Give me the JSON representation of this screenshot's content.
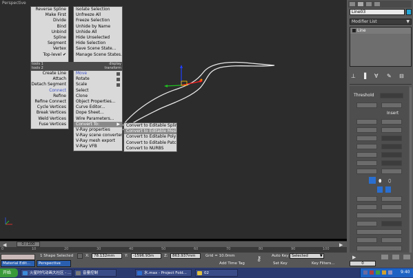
{
  "viewport": {
    "label": "Perspective"
  },
  "quad_tl": {
    "rows": [
      {
        "label": "Reverse Spline",
        "blue": false
      },
      {
        "label": "Make First",
        "blue": false
      },
      {
        "label": "Divide",
        "blue": false
      },
      {
        "label": "Bind",
        "blue": false
      },
      {
        "label": "Unbind",
        "blue": false
      },
      {
        "label": "Spline",
        "blue": false
      },
      {
        "label": "Segment",
        "blue": false
      },
      {
        "label": "Vertex",
        "blue": false
      },
      {
        "label": "Top-level",
        "blue": false
      }
    ],
    "header_left": "tools 1",
    "header_right": "display"
  },
  "quad_tr": {
    "rows": [
      {
        "label": "Isolate Selection"
      },
      {
        "label": "Unfreeze All"
      },
      {
        "label": "Freeze Selection"
      },
      {
        "label": "Unhide by Name"
      },
      {
        "label": "Unhide All"
      },
      {
        "label": "Hide Unselected"
      },
      {
        "label": "Hide Selection"
      },
      {
        "label": "Save Scene State..."
      },
      {
        "label": "Manage Scene States..."
      }
    ]
  },
  "quad_bl": {
    "header_left": "tools 2",
    "header_right": "transform",
    "rows": [
      {
        "label": "Create Line",
        "blue": false
      },
      {
        "label": "Attach",
        "blue": false
      },
      {
        "label": "Detach Segment",
        "blue": false
      },
      {
        "label": "Connect",
        "blue": true
      },
      {
        "label": "Refine",
        "blue": false
      },
      {
        "label": "Refine Connect",
        "blue": false
      },
      {
        "label": "Cycle Vertices",
        "blue": false
      },
      {
        "label": "Break Vertices",
        "blue": false
      },
      {
        "label": "Weld Vertices",
        "blue": false
      },
      {
        "label": "Fuse Vertices",
        "blue": false
      }
    ]
  },
  "quad_br": {
    "rows": [
      {
        "label": "Move",
        "blue": true
      },
      {
        "label": "Rotate",
        "blue": false
      },
      {
        "label": "Scale",
        "blue": false
      },
      {
        "label": "Select",
        "blue": false
      },
      {
        "label": "Clone",
        "blue": false
      },
      {
        "label": "Object Properties...",
        "blue": false
      },
      {
        "label": "Curve Editor...",
        "blue": false
      },
      {
        "label": "Dope Sheet...",
        "blue": false
      },
      {
        "label": "Wire Parameters...",
        "blue": false
      },
      {
        "label": "Convert To:",
        "blue": false
      },
      {
        "label": "V-Ray properties",
        "blue": false
      },
      {
        "label": "V-Ray scene converter",
        "blue": false
      },
      {
        "label": "V-Ray mesh export",
        "blue": false
      },
      {
        "label": "V-Ray VFB",
        "blue": false
      }
    ]
  },
  "submenu": {
    "items": [
      {
        "label": "Convert to Editable Spline"
      },
      {
        "label": "Convert to Editable Mesh"
      },
      {
        "label": "Convert to Editable Poly"
      },
      {
        "label": "Convert to Editable Patch"
      },
      {
        "label": "Convert to NURBS"
      }
    ]
  },
  "right_panel": {
    "object_name": "Line03",
    "modifier_list": "Modifier List",
    "stack_item": "Line",
    "threshold_label": "Threshold",
    "insert_label": "Insert"
  },
  "timeline": {
    "frame_counter": "0 / 100",
    "ticks": [
      "0",
      "10",
      "20",
      "30",
      "40",
      "50",
      "60",
      "70",
      "80",
      "90",
      "100"
    ]
  },
  "status": {
    "material_tab": "Material Edit...",
    "viewport_tab": "Perspective",
    "selection_info": "1 Shape Selected",
    "x_label": "X:",
    "x_value": "78.132mm",
    "y_label": "Y:",
    "y_value": "-1596.93m",
    "z_label": "Z:",
    "z_value": "863.937mm",
    "grid": "Grid = 10.0mm",
    "add_time_tag": "Add Time Tag",
    "auto_key": "Auto Key",
    "auto_key_value": "Selected",
    "set_key": "Set Key",
    "key_filters": "Key Filters...",
    "frame_field": "0"
  },
  "taskbar": {
    "start": "开始",
    "tasks": [
      {
        "label": "火星时代动画大社区 - ...",
        "color": "#3b8ad9"
      },
      {
        "label": "音量控制",
        "color": "#7a7a7a"
      },
      {
        "label": "水.max  - Project Fold...",
        "color": "#2f6fd0"
      },
      {
        "label": "02",
        "color": "#e0c040"
      }
    ],
    "clock": "9:40"
  }
}
